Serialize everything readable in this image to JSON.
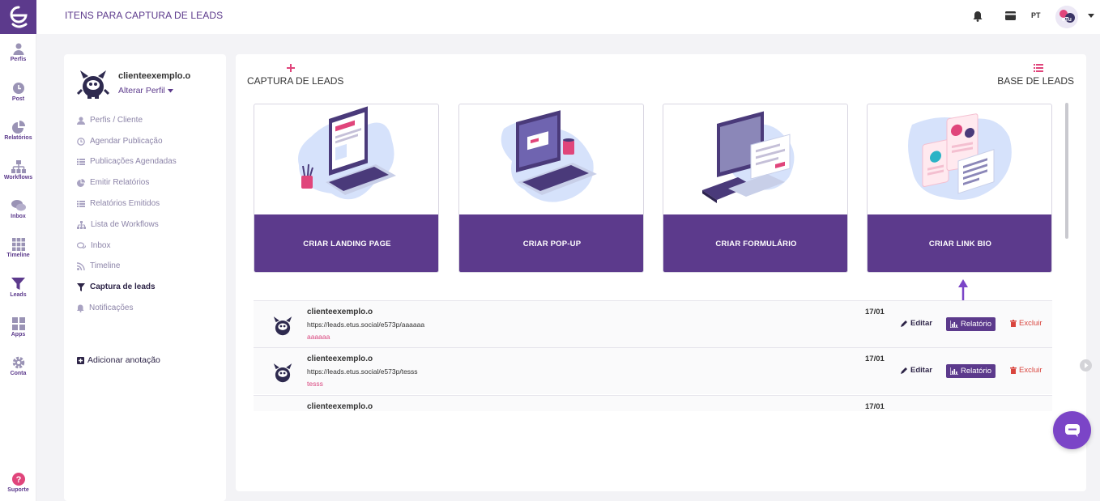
{
  "header": {
    "title": "ITENS PARA CAPTURA DE LEADS",
    "lang": "PT"
  },
  "rail": {
    "items": [
      {
        "label": "Perfis",
        "icon": "user-icon"
      },
      {
        "label": "Post",
        "icon": "clock-icon"
      },
      {
        "label": "Relatórios",
        "icon": "pie-chart-icon"
      },
      {
        "label": "Workflows",
        "icon": "sitemap-icon"
      },
      {
        "label": "Inbox",
        "icon": "chat-bubbles-icon"
      },
      {
        "label": "Timeline",
        "icon": "grid-icon"
      },
      {
        "label": "Leads",
        "icon": "filter-icon"
      },
      {
        "label": "Apps",
        "icon": "apps-icon"
      },
      {
        "label": "Conta",
        "icon": "gear-icon"
      },
      {
        "label": "Suporte",
        "icon": "help-icon"
      }
    ]
  },
  "profile": {
    "name": "clienteexemplo.o",
    "change_label": "Alterar Perfil",
    "menu": [
      {
        "label": "Perfis / Cliente",
        "icon": "user-icon"
      },
      {
        "label": "Agendar Publicação",
        "icon": "clock-icon"
      },
      {
        "label": "Publicações Agendadas",
        "icon": "list-icon"
      },
      {
        "label": "Emitir Relatórios",
        "icon": "pie-chart-icon"
      },
      {
        "label": "Relatórios Emitidos",
        "icon": "list-icon"
      },
      {
        "label": "Lista de Workflows",
        "icon": "sitemap-icon"
      },
      {
        "label": "Inbox",
        "icon": "chat-bubbles-icon"
      },
      {
        "label": "Timeline",
        "icon": "rss-icon"
      },
      {
        "label": "Captura de leads",
        "icon": "filter-icon",
        "active": true
      },
      {
        "label": "Notificações",
        "icon": "bell-icon"
      }
    ],
    "add_note": "Adicionar anotação"
  },
  "main": {
    "capture_label": "CAPTURA DE LEADS",
    "base_label": "BASE DE LEADS",
    "tiles": [
      {
        "label": "CRIAR LANDING PAGE"
      },
      {
        "label": "CRIAR POP-UP"
      },
      {
        "label": "CRIAR FORMULÁRIO"
      },
      {
        "label": "CRIAR LINK BIO"
      }
    ],
    "rows": [
      {
        "name": "clienteexemplo.o",
        "url": "https://leads.etus.social/e573p/aaaaaa",
        "tag": "aaaaaa",
        "date": "17/01",
        "edit": "Editar",
        "report": "Relatório",
        "delete": "Excluir"
      },
      {
        "name": "clienteexemplo.o",
        "url": "https://leads.etus.social/e573p/tesss",
        "tag": "tesss",
        "date": "17/01",
        "edit": "Editar",
        "report": "Relatório",
        "delete": "Excluir"
      },
      {
        "name": "clienteexemplo.o",
        "url": "",
        "tag": "",
        "date": "17/01",
        "edit": "",
        "report": "",
        "delete": ""
      }
    ]
  },
  "colors": {
    "brand": "#5c3a8c",
    "accent_red": "#d9453e",
    "chat": "#7b45c7"
  }
}
